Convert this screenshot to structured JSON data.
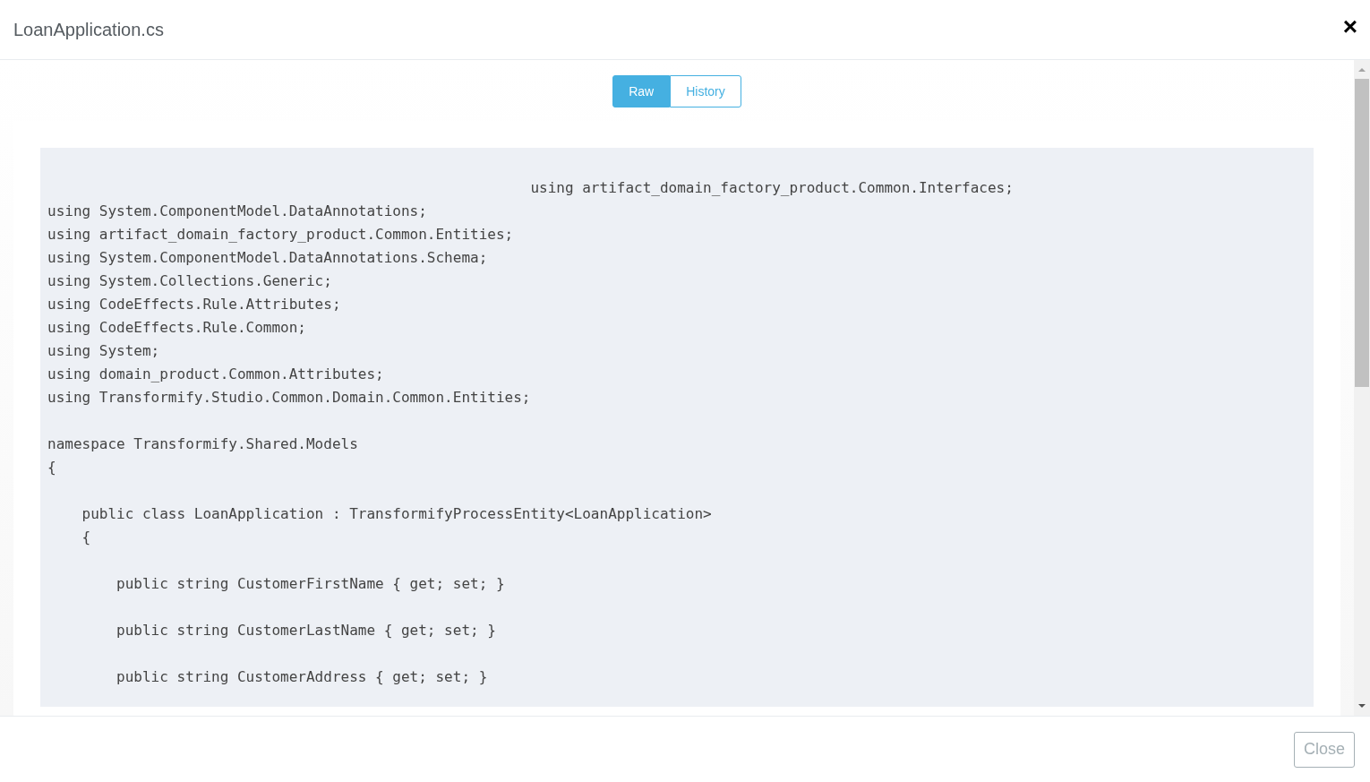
{
  "dialog": {
    "title": "LoanApplication.cs",
    "close_icon": "×"
  },
  "tabs": [
    {
      "label": "Raw",
      "selected": true
    },
    {
      "label": "History",
      "selected": false
    }
  ],
  "code": "                                                        using artifact_domain_factory_product.Common.Interfaces;\nusing System.ComponentModel.DataAnnotations;\nusing artifact_domain_factory_product.Common.Entities;\nusing System.ComponentModel.DataAnnotations.Schema;\nusing System.Collections.Generic;\nusing CodeEffects.Rule.Attributes;\nusing CodeEffects.Rule.Common;\nusing System;\nusing domain_product.Common.Attributes;\nusing Transformify.Studio.Common.Domain.Common.Entities;\n\nnamespace Transformify.Shared.Models\n{\n\n    public class LoanApplication : TransformifyProcessEntity<LoanApplication>\n    {\n\n        public string CustomerFirstName { get; set; }\n\n        public string CustomerLastName { get; set; }\n\n        public string CustomerAddress { get; set; }",
  "footer": {
    "close_button": "Close"
  }
}
